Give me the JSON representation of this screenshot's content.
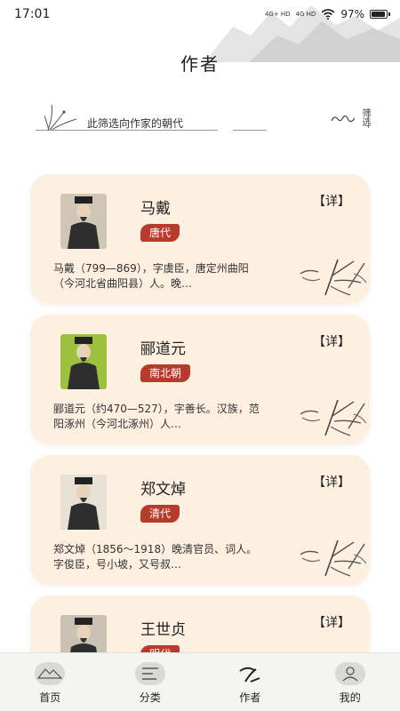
{
  "status": {
    "time": "17:01",
    "net1": "4G+ HD",
    "net2": "4G HD",
    "battery": "97%",
    "battery_level": 0.97
  },
  "page": {
    "title": "作者"
  },
  "filter": {
    "hint": "此筛选向作家的朝代",
    "button_label": "筛选"
  },
  "authors": [
    {
      "name": "马戴",
      "dynasty": "唐代",
      "bio": "马戴（799—869），字虞臣，唐定州曲阳（今河北省曲阳县）人。晚…",
      "detail": "【详】",
      "portrait_tone": "#cfc6b6"
    },
    {
      "name": "郦道元",
      "dynasty": "南北朝",
      "bio": "郦道元（约470—527），字善长。汉族，范阳涿州（今河北涿州）人…",
      "detail": "【详】",
      "portrait_tone": "#9dc13e"
    },
    {
      "name": "郑文焯",
      "dynasty": "清代",
      "bio": "郑文焯（1856～1918）晚清官员、词人。字俊臣，号小坡，又号叔…",
      "detail": "【详】",
      "portrait_tone": "#e6e1d4"
    },
    {
      "name": "王世贞",
      "dynasty": "明代",
      "bio": "",
      "detail": "【详】",
      "portrait_tone": "#c9c2b4"
    }
  ],
  "nav": [
    {
      "label": "首页",
      "icon": "mountain-icon",
      "active": false
    },
    {
      "label": "分类",
      "icon": "category-icon",
      "active": false
    },
    {
      "label": "作者",
      "icon": "brush-icon",
      "active": true
    },
    {
      "label": "我的",
      "icon": "profile-icon",
      "active": false
    }
  ],
  "colors": {
    "card_bg": "#fdf0e1",
    "badge": "#b83a2b",
    "nav_bg": "#f4f4f2"
  }
}
